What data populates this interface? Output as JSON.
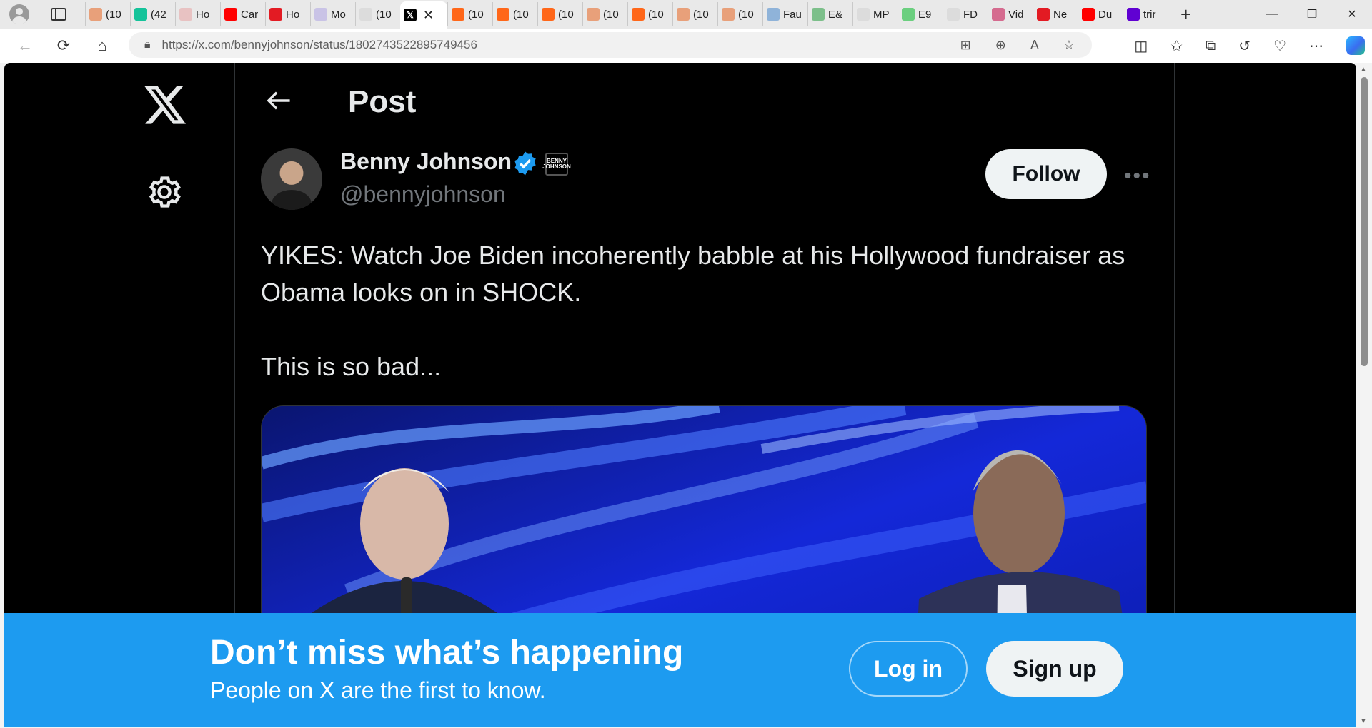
{
  "browser": {
    "tabs": [
      {
        "label": "(10",
        "icon": "substack-icon",
        "color": "#e8a07a"
      },
      {
        "label": "(42",
        "icon": "grammarly-icon",
        "color": "#15c39a"
      },
      {
        "label": "Ho",
        "icon": "bi-icon",
        "color": "#e8c2c2"
      },
      {
        "label": "Car",
        "icon": "youtube-icon",
        "color": "#ff0000"
      },
      {
        "label": "Ho",
        "icon": "shield-icon",
        "color": "#e31b23"
      },
      {
        "label": "Mo",
        "icon": "ai-icon",
        "color": "#c9c3e6"
      },
      {
        "label": "(10",
        "icon": "page-icon",
        "color": "#dcdcdc"
      },
      {
        "label": "",
        "icon": "x-icon",
        "color": "#000000",
        "active": true
      },
      {
        "label": "(10",
        "icon": "substack-icon",
        "color": "#ff6719"
      },
      {
        "label": "(10",
        "icon": "substack-icon",
        "color": "#ff6719"
      },
      {
        "label": "(10",
        "icon": "substack-icon",
        "color": "#ff6719"
      },
      {
        "label": "(10",
        "icon": "substack-icon",
        "color": "#e8a07a"
      },
      {
        "label": "(10",
        "icon": "substack-icon",
        "color": "#ff6719"
      },
      {
        "label": "(10",
        "icon": "substack-icon",
        "color": "#e8a07a"
      },
      {
        "label": "(10",
        "icon": "substack-icon",
        "color": "#e8a07a"
      },
      {
        "label": "Fau",
        "icon": "chart-icon",
        "color": "#8fb3d9"
      },
      {
        "label": "E&",
        "icon": "circle-icon",
        "color": "#7cbf8a"
      },
      {
        "label": "MP",
        "icon": "page-icon",
        "color": "#dcdcdc"
      },
      {
        "label": "E9",
        "icon": "play-icon",
        "color": "#6bcf7f"
      },
      {
        "label": "FD",
        "icon": "page-icon",
        "color": "#dcdcdc"
      },
      {
        "label": "Vid",
        "icon": "star-icon",
        "color": "#d56b8f"
      },
      {
        "label": "Ne",
        "icon": "r-icon",
        "color": "#e31b23"
      },
      {
        "label": "Du",
        "icon": "youtube-icon",
        "color": "#ff0000"
      },
      {
        "label": "trir",
        "icon": "yahoo-icon",
        "color": "#6001d2"
      }
    ],
    "url": "https://x.com/bennyjohnson/status/1802743522895749456"
  },
  "post": {
    "header_title": "Post",
    "author_name": "Benny Johnson",
    "author_handle": "@bennyjohnson",
    "affiliate_badge_text": "BENNY JOHNSON",
    "follow_label": "Follow",
    "more_label": "•••",
    "text_paragraphs": [
      "YIKES: Watch Joe Biden incoherently babble at his Hollywood fundraiser as Obama looks on in SHOCK.",
      "This is so bad..."
    ]
  },
  "banner": {
    "title": "Don’t miss what’s happening",
    "subtitle": "People on X are the first to know.",
    "login_label": "Log in",
    "signup_label": "Sign up"
  },
  "colors": {
    "accent": "#1d9bf0",
    "background": "#000000",
    "text_primary": "#e7e9ea",
    "text_secondary": "#71767b"
  }
}
